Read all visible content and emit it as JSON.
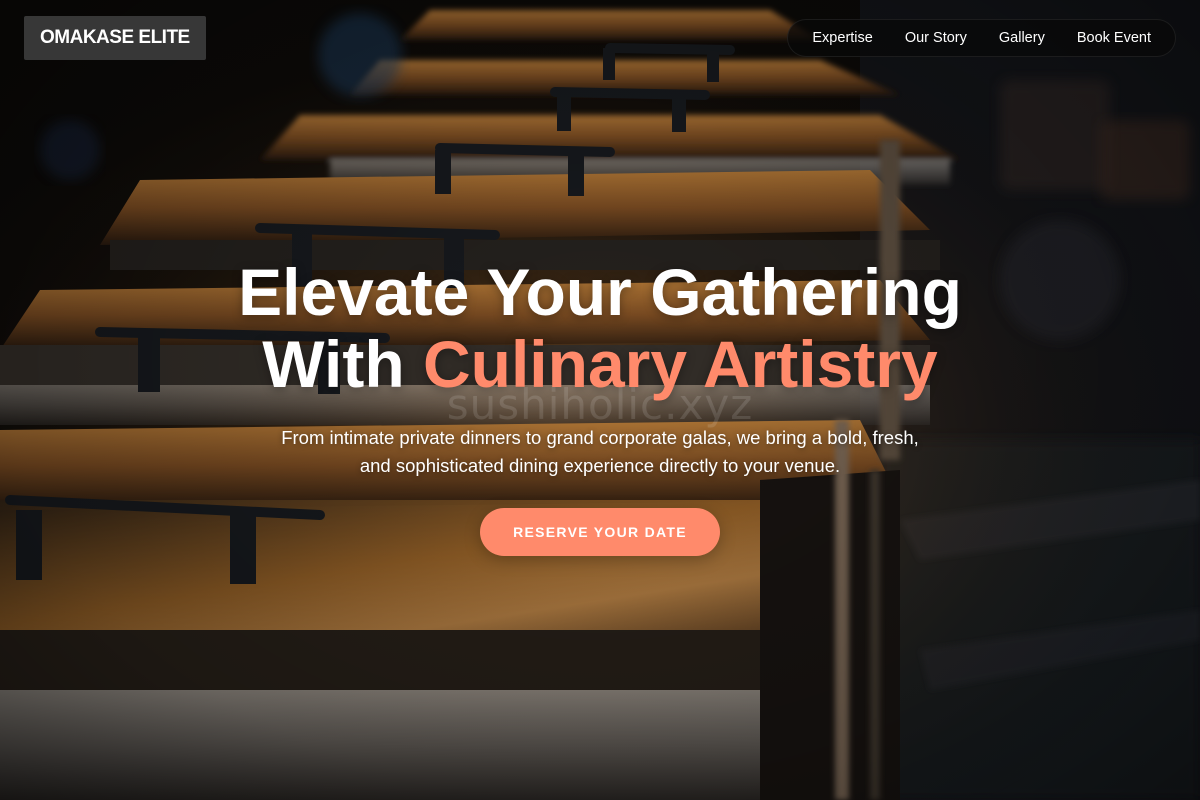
{
  "brand": {
    "logo_text": "OMAKASE ELITE"
  },
  "nav": {
    "items": [
      {
        "label": "Expertise"
      },
      {
        "label": "Our Story"
      },
      {
        "label": "Gallery"
      },
      {
        "label": "Book Event"
      }
    ]
  },
  "hero": {
    "headline_line1": "Elevate Your Gathering",
    "headline_line2_prefix": "With ",
    "headline_line2_accent": "Culinary Artistry",
    "watermark": "sushiholic.xyz",
    "subtitle": "From intimate private dinners to grand corporate galas, we bring a bold, fresh, and sophisticated dining experience directly to your venue.",
    "cta_label": "RESERVE YOUR DATE"
  },
  "colors": {
    "accent": "#ff8a6b",
    "logo_bg": "#3c3c3c",
    "nav_bg": "#080808"
  }
}
